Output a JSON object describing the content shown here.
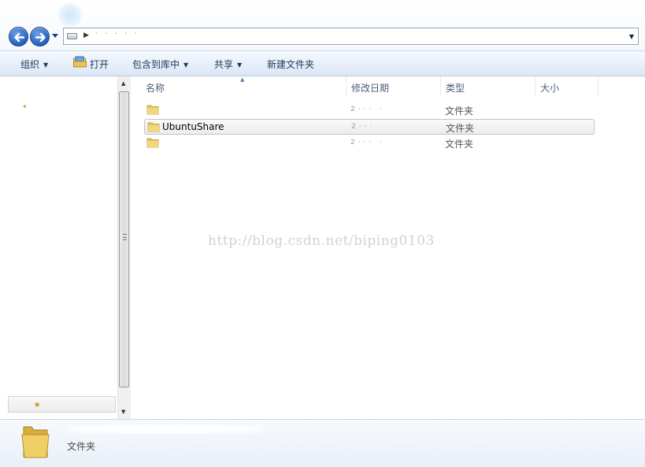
{
  "window": {
    "back_icon": "back-arrow-icon",
    "forward_icon": "forward-arrow-icon",
    "address_icon": "drive-icon",
    "address_text": "· · · · ·"
  },
  "toolbar": {
    "organize": "组织",
    "open": "打开",
    "include_in_library": "包含到库中",
    "share": "共享",
    "new_folder": "新建文件夹"
  },
  "columns": {
    "name": "名称",
    "date_modified": "修改日期",
    "type": "类型",
    "size": "大小"
  },
  "files": [
    {
      "name": "",
      "date": "2··· ·",
      "type": "文件夹",
      "selected": false
    },
    {
      "name": "UbuntuShare",
      "date": "2···",
      "type": "文件夹",
      "selected": true
    },
    {
      "name": "",
      "date": "2··· ·",
      "type": "文件夹",
      "selected": false
    }
  ],
  "watermark": "http://blog.csdn.net/biping0103",
  "details": {
    "type": "文件夹"
  },
  "colors": {
    "toolbar_text": "#1e395b",
    "header_text": "#4c607a",
    "folder_yellow": "#e8c55a",
    "nav_button_blue": "#2d68c4"
  }
}
